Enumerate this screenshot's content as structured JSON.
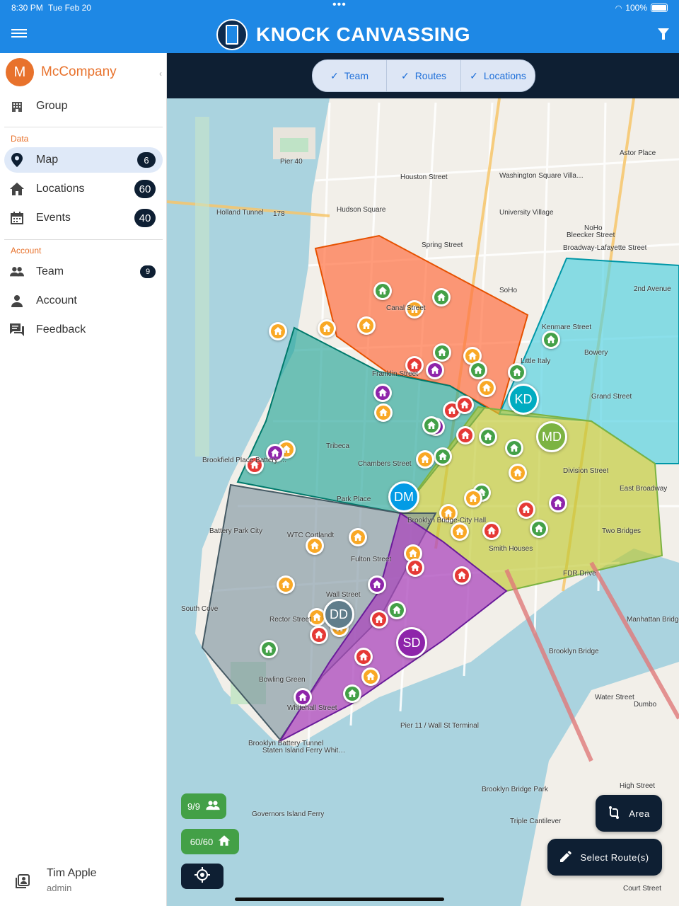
{
  "status_bar": {
    "time": "8:30 PM",
    "date": "Tue Feb 20",
    "battery": "100%"
  },
  "app": {
    "title": "KNOCK CANVASSING"
  },
  "sidebar": {
    "company_initial": "M",
    "company_name": "McCompany",
    "group_label": "Group",
    "data_section": "Data",
    "items_data": [
      {
        "label": "Map",
        "count": "6"
      },
      {
        "label": "Locations",
        "count": "60"
      },
      {
        "label": "Events",
        "count": "40"
      }
    ],
    "account_section": "Account",
    "items_account": [
      {
        "label": "Team",
        "count": "9"
      },
      {
        "label": "Account"
      },
      {
        "label": "Feedback"
      }
    ],
    "user": {
      "name": "Tim Apple",
      "role": "admin"
    }
  },
  "map_filters": [
    {
      "label": "Team",
      "checked": true
    },
    {
      "label": "Routes",
      "checked": true
    },
    {
      "label": "Locations",
      "checked": true
    }
  ],
  "map_controls": {
    "team_count": "9/9",
    "location_count": "60/60",
    "area_label": "Area",
    "select_routes_label": "Select Route(s)"
  },
  "team_markers": [
    {
      "initials": "KD",
      "color": "#00acc1"
    },
    {
      "initials": "MD",
      "color": "#7cb342"
    },
    {
      "initials": "DM",
      "color": "#039be5"
    },
    {
      "initials": "DD",
      "color": "#607d8b"
    },
    {
      "initials": "SD",
      "color": "#8e24aa"
    }
  ],
  "map_labels": [
    "Pier 40",
    "Holland Tunnel",
    "178",
    "Hudson Square",
    "Houston Street",
    "Spring Street",
    "Washington Square Village",
    "University Village",
    "Astor Place",
    "NoHo",
    "Bleecker Street",
    "Broadway-Lafayette Street",
    "SoHo",
    "Canal Street",
    "Kenmare Street",
    "Bowery",
    "2nd Avenue",
    "Little Italy",
    "Grand Street",
    "Franklin Street",
    "Tribeca",
    "Chambers Street",
    "Park Place",
    "Division Street",
    "East Broadway",
    "Two Bridges",
    "Brooklyn Bridge-City Hall",
    "Smith Houses",
    "FDR Drive",
    "WTC Cortlandt",
    "Fulton Street",
    "Battery Park City",
    "Rector Street",
    "Wall Street",
    "Bowling Green",
    "Whitehall Street",
    "Staten Island Ferry Whitehall Terminal",
    "South Cove",
    "Manhattan Bridge",
    "Brooklyn Bridge",
    "Dumbo",
    "Water Street",
    "High Street",
    "Brooklyn Bridge Park",
    "Triple Cantilever",
    "Court Street",
    "Pier 11 / Wall St Terminal",
    "Brooklyn Battery Tunnel",
    "Governors Island Ferry",
    "Brookfield Place Battery Park City"
  ]
}
